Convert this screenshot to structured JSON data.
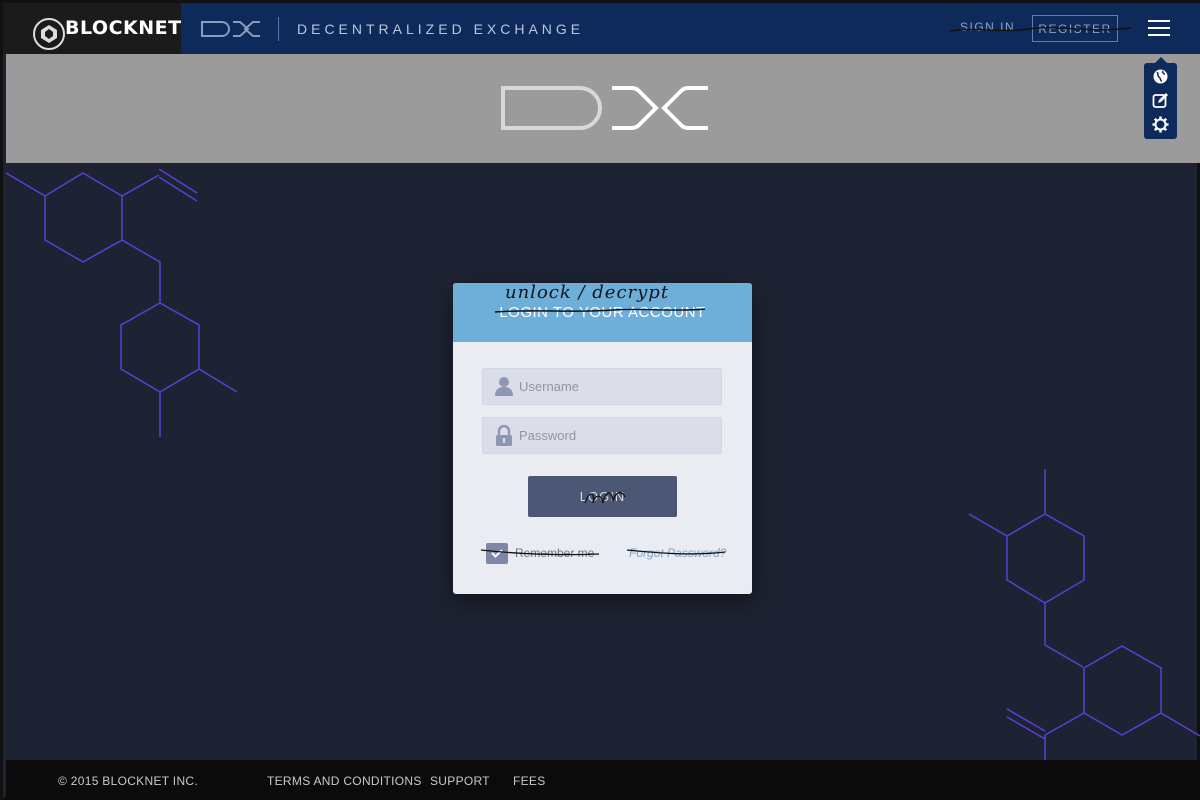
{
  "header": {
    "brand": "BLOCKNET",
    "tagline": "DECENTRALIZED EXCHANGE",
    "sign_in": "SIGN IN",
    "register": "REGISTER"
  },
  "side_tools": [
    "globe-icon",
    "edit-icon",
    "gear-icon"
  ],
  "login": {
    "title": "LOGIN TO YOUR ACCOUNT",
    "handwritten_title": "unlock / decrypt",
    "username_placeholder": "Username",
    "password_placeholder": "Password",
    "button": "LOGIN",
    "remember": "Remember me",
    "remember_checked": true,
    "forgot": "Forgot Password?"
  },
  "footer": {
    "copyright": "© 2015 BLOCKNET INC.",
    "terms": "TERMS AND CONDITIONS",
    "support": "SUPPORT",
    "fees": "FEES"
  },
  "colors": {
    "topbar": "#0e2a5a",
    "brand_bg": "#1b1b1b",
    "hero": "#9b9b9b",
    "background": "#1e2333",
    "card_header": "#6dafd9",
    "button": "#4b5774",
    "hexagon_lines": "#5b3fd6"
  }
}
